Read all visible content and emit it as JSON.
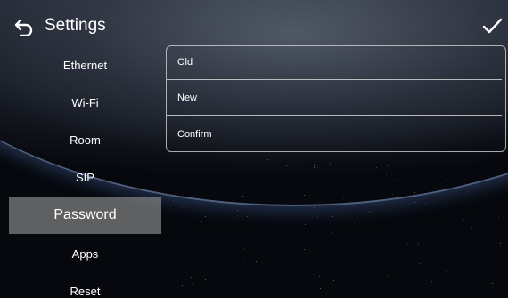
{
  "header": {
    "title": "Settings",
    "back_icon": "back-arrow-icon",
    "confirm_icon": "checkmark-icon"
  },
  "sidebar": {
    "items": [
      {
        "label": "Ethernet",
        "active": false
      },
      {
        "label": "Wi-Fi",
        "active": false
      },
      {
        "label": "Room",
        "active": false
      },
      {
        "label": "SIP",
        "active": false
      },
      {
        "label": "Password",
        "active": true
      },
      {
        "label": "Apps",
        "active": false
      },
      {
        "label": "Reset",
        "active": false
      }
    ]
  },
  "password_form": {
    "fields": [
      {
        "label": "Old",
        "value": ""
      },
      {
        "label": "New",
        "value": ""
      },
      {
        "label": "Confirm",
        "value": ""
      }
    ]
  },
  "colors": {
    "active_item_bg": "#969696",
    "field_border": "#dcdcdc",
    "text": "#ffffff"
  }
}
